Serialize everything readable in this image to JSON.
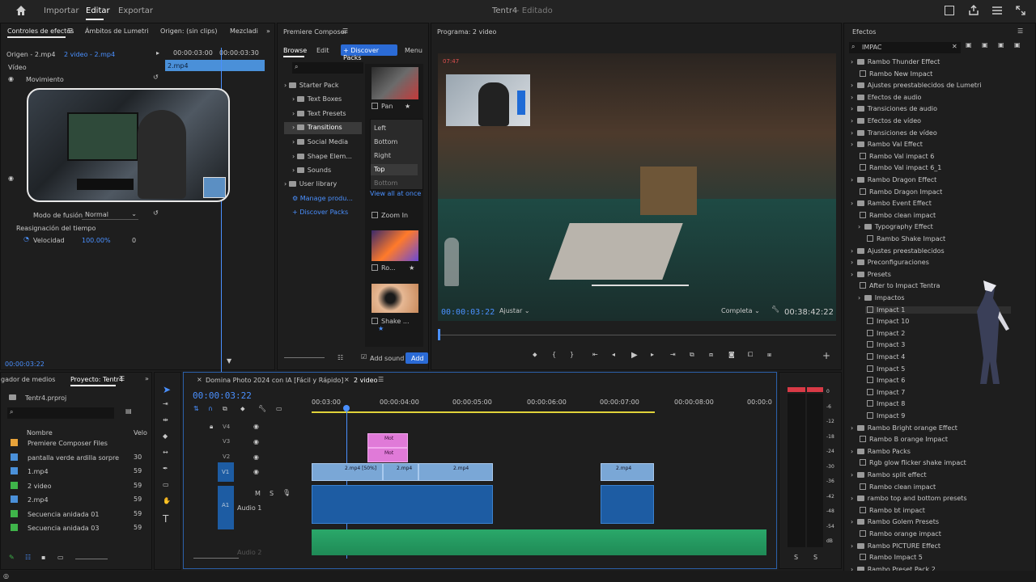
{
  "app": {
    "title": "Tentr4",
    "status": "- Editado",
    "nav": [
      "Importar",
      "Editar",
      "Exportar"
    ]
  },
  "effect_controls": {
    "tabs": [
      "Controles de efectos",
      "Ámbitos de Lumetri",
      "Origen: (sin clips)",
      "Mezcladi"
    ],
    "source": "Origen - 2.mp4",
    "sequence": "2 video - 2.mp4",
    "ruler": [
      "00:00:03:00",
      "00:00:03:30"
    ],
    "clip_label": "2.mp4",
    "section_video": "Vídeo",
    "movement": "Movimiento",
    "blend_label": "Modo de fusión",
    "blend_value": "Normal",
    "time_remap": "Reasignación del tiempo",
    "speed_label": "Velocidad",
    "speed_value": "100.00%",
    "speed_extra": "0",
    "timecode": "00:00:03:22"
  },
  "composer": {
    "title": "Premiere Composer",
    "tabs": [
      "Browse",
      "Edit"
    ],
    "discover_btn": "+ Discover Packs",
    "menu_btn": "Menu",
    "tree": [
      "Starter Pack",
      "Text Boxes",
      "Text Presets",
      "Transitions",
      "Social Media",
      "Shape Elem...",
      "Sounds",
      "User library",
      "Manage produ...",
      "Discover Packs"
    ],
    "previews": [
      "Pan",
      "Zoom In",
      "Ro...",
      "Shake ..."
    ],
    "direction_menu": [
      "Left",
      "Bottom",
      "Right",
      "Top",
      "Bottom"
    ],
    "view_all": "View all at once",
    "add_sound": "Add sound",
    "add_btn": "Add"
  },
  "program": {
    "title": "Programa: 2 video",
    "timecode": "00:00:03:22",
    "fit": "Ajustar",
    "quality": "Completa",
    "duration": "00:38:42:22",
    "hud_time": "07:47"
  },
  "project": {
    "tabs": [
      "gador de medios",
      "Proyecto: Tentr4"
    ],
    "file": "Tentr4.prproj",
    "col_name": "Nombre",
    "col_rate": "Velo",
    "items": [
      {
        "name": "Premiere Composer Files",
        "color": "#e8a33a",
        "rate": ""
      },
      {
        "name": "pantalla verde ardilla sorpre",
        "color": "#4a90d9",
        "rate": "30"
      },
      {
        "name": "1.mp4",
        "color": "#4a90d9",
        "rate": "59"
      },
      {
        "name": "2 video",
        "color": "#3fb44a",
        "rate": "59"
      },
      {
        "name": "2.mp4",
        "color": "#4a90d9",
        "rate": "59"
      },
      {
        "name": "Secuencia anidada 01",
        "color": "#3fb44a",
        "rate": "59"
      },
      {
        "name": "Secuencia anidada 03",
        "color": "#3fb44a",
        "rate": "59"
      }
    ]
  },
  "timeline": {
    "tabs": [
      "Domina Photo 2024 con IA [Fácil y Rápido]",
      "2 video"
    ],
    "timecode": "00:00:03:22",
    "ruler": [
      "00:03:00",
      "00:00:04:00",
      "00:00:05:00",
      "00:00:06:00",
      "00:00:07:00",
      "00:00:08:00",
      "00:00:0"
    ],
    "tracks": [
      "V4",
      "V3",
      "V2",
      "V1",
      "A1"
    ],
    "audio_name": "Audio 1",
    "audio2": "Audio 2",
    "clips": [
      "2.mp4 [50%]",
      "2.mp4",
      "2.mp4",
      "2.mp4"
    ],
    "pink_clips": [
      "Mot",
      "Mot"
    ]
  },
  "meter": {
    "scale": [
      "0",
      "-6",
      "-12",
      "-18",
      "-24",
      "-30",
      "-36",
      "-42",
      "-48",
      "-54",
      "dB"
    ],
    "solo": [
      "S",
      "S"
    ]
  },
  "effects": {
    "title": "Efectos",
    "search": "IMPAC",
    "items": [
      {
        "label": "Rambo Thunder Effect",
        "kind": "folder",
        "indent": 0
      },
      {
        "label": "Rambo New Impact",
        "kind": "fx",
        "indent": 1
      },
      {
        "label": "Ajustes preestablecidos de Lumetri",
        "kind": "folder",
        "indent": 0
      },
      {
        "label": "Efectos de audio",
        "kind": "folder",
        "indent": 0
      },
      {
        "label": "Transiciones de audio",
        "kind": "folder",
        "indent": 0
      },
      {
        "label": "Efectos de vídeo",
        "kind": "folder",
        "indent": 0
      },
      {
        "label": "Transiciones de vídeo",
        "kind": "folder",
        "indent": 0
      },
      {
        "label": "Rambo Val Effect",
        "kind": "folder",
        "indent": 0
      },
      {
        "label": "Rambo Val impact 6",
        "kind": "fx",
        "indent": 1
      },
      {
        "label": "Rambo Val impact 6_1",
        "kind": "fx",
        "indent": 1
      },
      {
        "label": "Rambo Dragon Effect",
        "kind": "folder",
        "indent": 0
      },
      {
        "label": "Rambo Dragon Impact",
        "kind": "fx",
        "indent": 1
      },
      {
        "label": "Rambo Event Effect",
        "kind": "folder",
        "indent": 0
      },
      {
        "label": "Rambo clean impact",
        "kind": "fx",
        "indent": 1
      },
      {
        "label": "Typography Effect",
        "kind": "folder",
        "indent": 1
      },
      {
        "label": "Rambo Shake Impact",
        "kind": "fx",
        "indent": 2
      },
      {
        "label": "Ajustes preestablecidos",
        "kind": "folder",
        "indent": 0
      },
      {
        "label": "Preconfiguraciones",
        "kind": "folder",
        "indent": 0
      },
      {
        "label": "Presets",
        "kind": "folder",
        "indent": 0
      },
      {
        "label": "After to Impact Tentra",
        "kind": "fx",
        "indent": 1
      },
      {
        "label": "Impactos",
        "kind": "folder",
        "indent": 1
      },
      {
        "label": "Impact 1",
        "kind": "fx",
        "indent": 2
      },
      {
        "label": "Impact 10",
        "kind": "fx",
        "indent": 2
      },
      {
        "label": "Impact 2",
        "kind": "fx",
        "indent": 2
      },
      {
        "label": "Impact 3",
        "kind": "fx",
        "indent": 2
      },
      {
        "label": "Impact 4",
        "kind": "fx",
        "indent": 2
      },
      {
        "label": "Impact 5",
        "kind": "fx",
        "indent": 2
      },
      {
        "label": "Impact 6",
        "kind": "fx",
        "indent": 2
      },
      {
        "label": "Impact 7",
        "kind": "fx",
        "indent": 2
      },
      {
        "label": "Impact 8",
        "kind": "fx",
        "indent": 2
      },
      {
        "label": "Impact 9",
        "kind": "fx",
        "indent": 2
      },
      {
        "label": "Rambo Bright orange Effect",
        "kind": "folder",
        "indent": 0
      },
      {
        "label": "Rambo B orange Impact",
        "kind": "fx",
        "indent": 1
      },
      {
        "label": "Rambo Packs",
        "kind": "folder",
        "indent": 0
      },
      {
        "label": "Rgb glow flicker shake impact",
        "kind": "fx",
        "indent": 1
      },
      {
        "label": "Rambo split effect",
        "kind": "folder",
        "indent": 0
      },
      {
        "label": "Rambo clean impact",
        "kind": "fx",
        "indent": 1
      },
      {
        "label": "rambo top and bottom presets",
        "kind": "folder",
        "indent": 0
      },
      {
        "label": "Rambo bt impact",
        "kind": "fx",
        "indent": 1
      },
      {
        "label": "Rambo Golem Presets",
        "kind": "folder",
        "indent": 0
      },
      {
        "label": "Rambo orange impact",
        "kind": "fx",
        "indent": 1
      },
      {
        "label": "Rambo PICTURE Effect",
        "kind": "folder",
        "indent": 0
      },
      {
        "label": "Rambo Impact 5",
        "kind": "fx",
        "indent": 1
      },
      {
        "label": "Rambo Preset Pack 2",
        "kind": "folder",
        "indent": 0
      }
    ]
  }
}
